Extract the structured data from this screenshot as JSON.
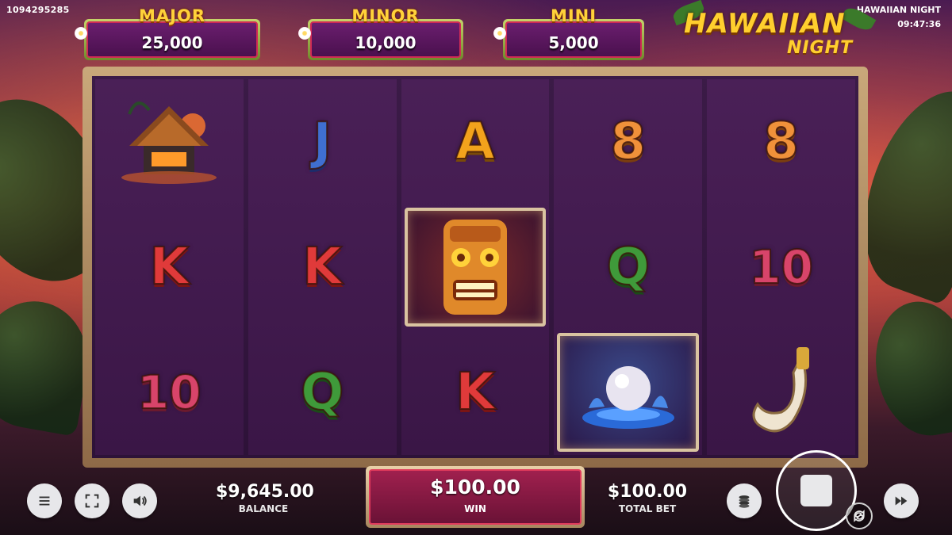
{
  "session_id": "1094295285",
  "game_name": "HAWAIIAN NIGHT",
  "clock": "09:47:36",
  "logo": {
    "line1": "HAWAIIAN",
    "line2": "NIGHT"
  },
  "jackpots": [
    {
      "title": "MAJOR",
      "value": "25,000"
    },
    {
      "title": "MINOR",
      "value": "10,000"
    },
    {
      "title": "MINI",
      "value": "5,000"
    }
  ],
  "reels": [
    {
      "symbols": [
        "hut-icon",
        "K",
        "10"
      ]
    },
    {
      "symbols": [
        "J",
        "K",
        "Q"
      ]
    },
    {
      "symbols": [
        "A",
        "tiki-icon",
        "K"
      ]
    },
    {
      "symbols": [
        "8",
        "Q",
        "pearl-icon"
      ]
    },
    {
      "symbols": [
        "8",
        "10",
        "hook-icon"
      ]
    }
  ],
  "balance": {
    "amount": "$9,645.00",
    "label": "BALANCE"
  },
  "win": {
    "amount": "$100.00",
    "label": "WIN"
  },
  "total_bet": {
    "amount": "$100.00",
    "label": "TOTAL BET"
  },
  "icons": {
    "menu": "menu-icon",
    "fullscreen": "fullscreen-icon",
    "sound": "speaker-icon",
    "coins": "coins-icon",
    "spin": "stop-icon",
    "autoplay": "autoplay-icon",
    "turbo": "fast-forward-icon"
  },
  "colors": {
    "accent_gold": "#ffd23a",
    "panel_purple": "#4a104e",
    "win_red": "#a0204e"
  }
}
